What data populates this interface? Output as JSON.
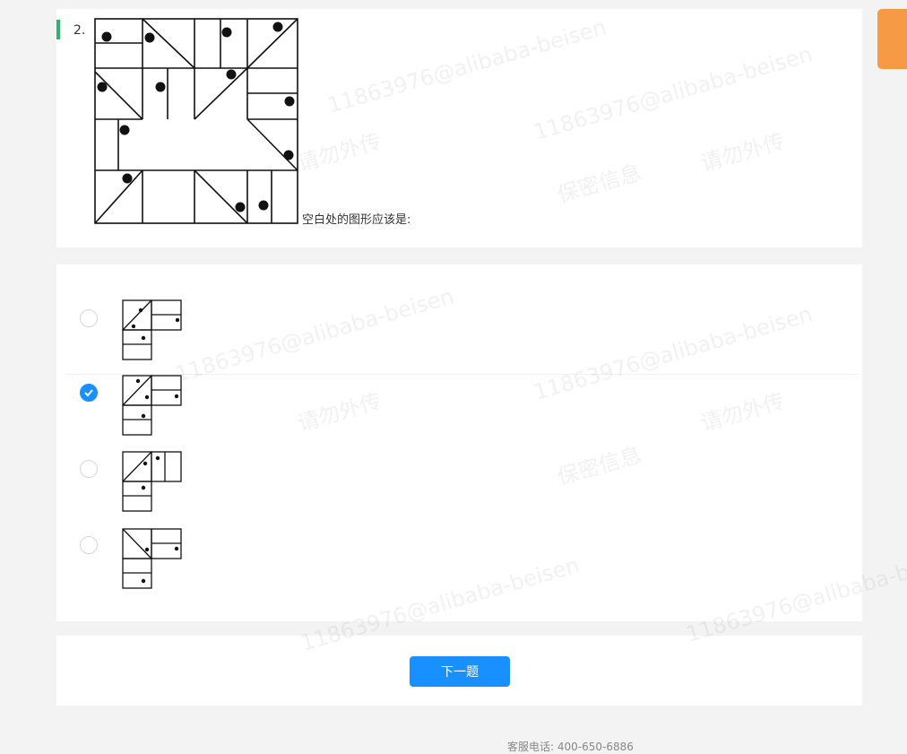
{
  "question": {
    "number": "2.",
    "text": "空白处的图形应该是:"
  },
  "options": [
    {
      "id": "A",
      "checked": false
    },
    {
      "id": "B",
      "checked": true
    },
    {
      "id": "C",
      "checked": false
    },
    {
      "id": "D",
      "checked": false
    }
  ],
  "nav": {
    "next_label": "下一题"
  },
  "footer": {
    "phone": "客服电话: 400-650-6886"
  },
  "watermark": {
    "id_text": "11863976@alibaba-beisen",
    "notice_1": "请勿外传",
    "notice_2": "保密信息"
  },
  "colors": {
    "primary": "#1890ff",
    "marker": "#2fb36f",
    "side_tab": "#f79a45"
  }
}
